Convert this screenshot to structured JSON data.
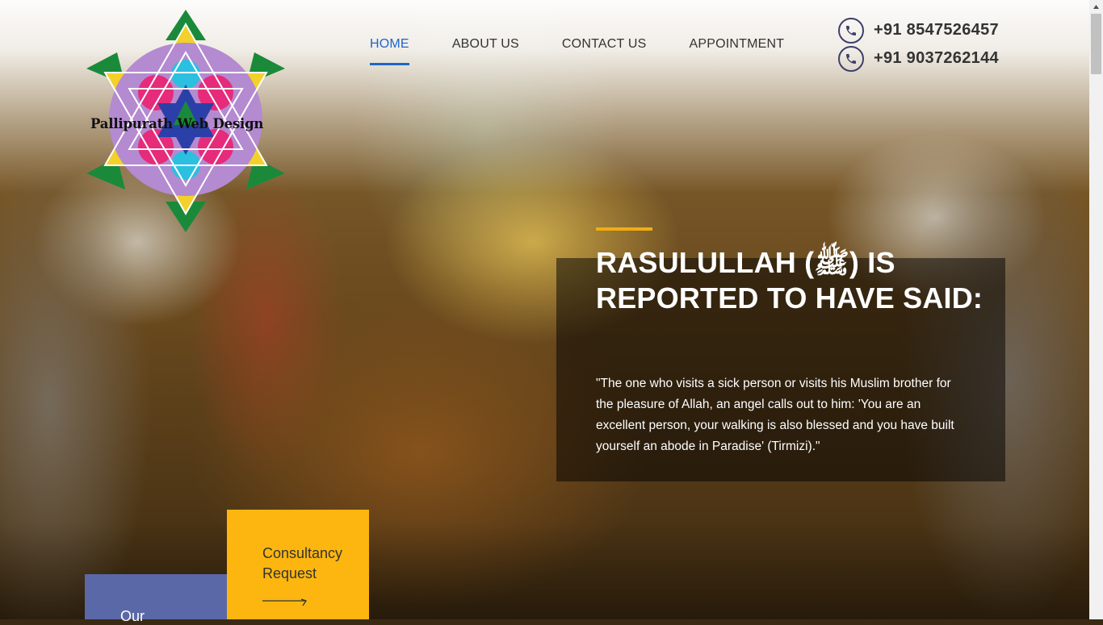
{
  "brand": {
    "logo_text": "Pallipurath Web Design"
  },
  "nav": {
    "items": [
      {
        "label": "HOME",
        "active": true
      },
      {
        "label": "ABOUT US"
      },
      {
        "label": "CONTACT US"
      },
      {
        "label": "APPOINTMENT"
      }
    ]
  },
  "contact": {
    "phones": [
      "+91 8547526457",
      "+91 9037262144"
    ],
    "icon": "phone-icon"
  },
  "hero": {
    "title": "RASULULLAH (ﷺ) IS REPORTED TO HAVE SAID:",
    "quote": "\"The one who visits a sick person or visits his Muslim brother for the pleasure of Allah, an angel calls out to him: 'You are an excellent person, your walking is also blessed and you have built yourself an abode in Paradise' (Tirmizi).\""
  },
  "cards": {
    "first_label": "Our",
    "second_label": "Consultancy Request"
  },
  "colors": {
    "accent": "#1e66c8",
    "highlight": "#fdb60f",
    "card_blue": "#5b68a8"
  }
}
